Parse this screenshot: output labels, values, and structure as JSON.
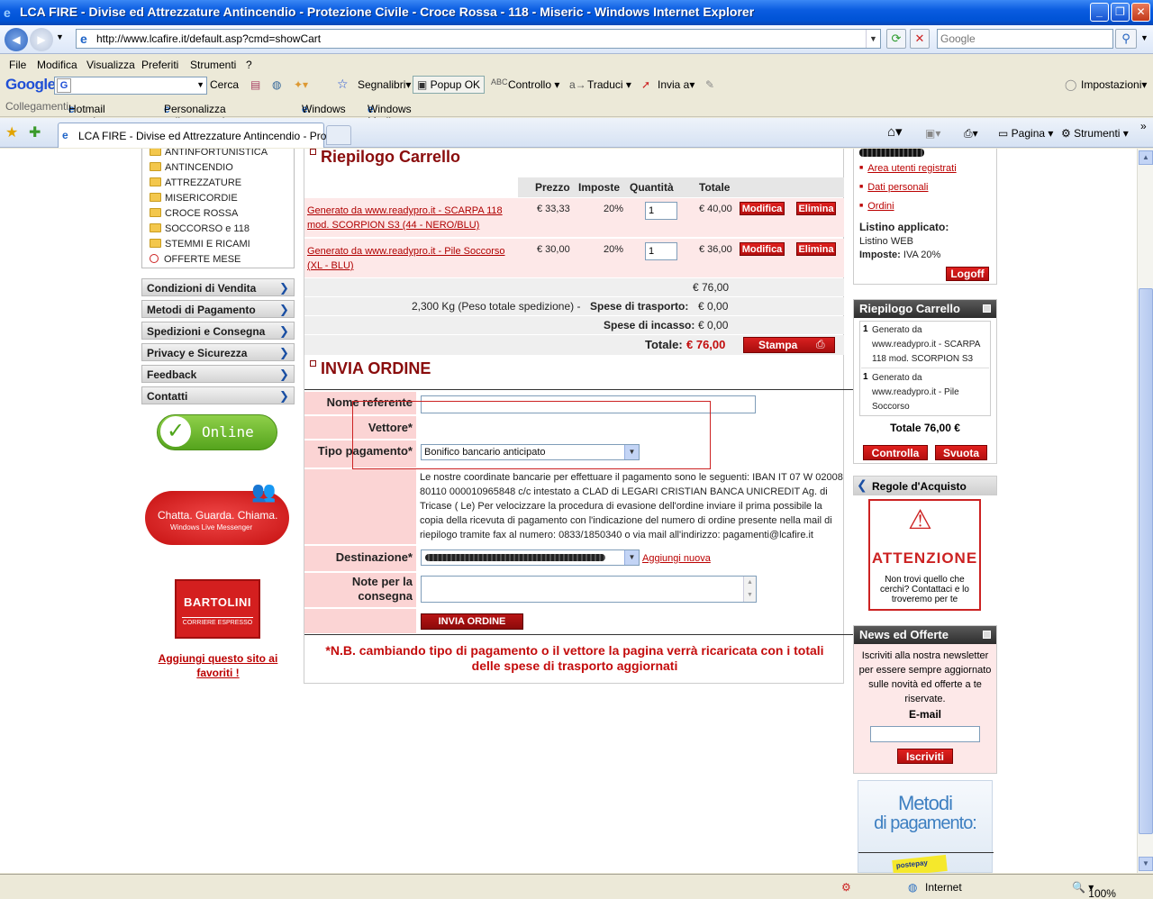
{
  "window": {
    "title": "LCA FIRE - Divise ed Attrezzature Antincendio - Protezione Civile - Croce Rossa - 118 - Miseric - Windows Internet Explorer",
    "url": "http://www.lcafire.it/default.asp?cmd=showCart",
    "search_placeholder": "Google"
  },
  "menu": [
    "File",
    "Modifica",
    "Visualizza",
    "Preferiti",
    "Strumenti",
    "?"
  ],
  "googlebar": {
    "logo": "Google",
    "cerca": "Cerca",
    "segnalibri": "Segnalibri",
    "popup": "Popup OK",
    "controllo": "Controllo",
    "traduci": "Traduci",
    "invia": "Invia a",
    "impostazioni": "Impostazioni"
  },
  "links": {
    "label": "Collegamenti",
    "items": [
      "Hotmail gratuita",
      "Personalizza collegamenti",
      "Windows",
      "Windows Media"
    ]
  },
  "tab": {
    "title": "LCA FIRE - Divise ed Attrezzature Antincendio - Prote...",
    "pagina": "Pagina",
    "strumenti": "Strumenti"
  },
  "categories": [
    "ANTINFORTUNISTICA",
    "ANTINCENDIO",
    "ATTREZZATURE",
    "MISERICORDIE",
    "CROCE ROSSA",
    "SOCCORSO e 118",
    "STEMMI E RICAMI",
    "OFFERTE MESE"
  ],
  "nav": [
    "Condizioni di Vendita",
    "Metodi di Pagamento",
    "Spedizioni e Consegna",
    "Privacy e Sicurezza",
    "Feedback",
    "Contatti"
  ],
  "left": {
    "online": "Online",
    "messenger": "Chatta. Guarda. Chiama.",
    "messenger_sub": "Windows Live Messenger",
    "bartolini": "BARTOLINI",
    "bartolini_sub": "CORRIERE ESPRESSO",
    "fav": "Aggiungi questo sito ai favoriti !"
  },
  "cart": {
    "title": "Riepilogo Carrello",
    "headers": {
      "price": "Prezzo",
      "tax": "Imposte",
      "qty": "Quantità",
      "total": "Totale"
    },
    "rows": [
      {
        "product": "Generato da www.readypro.it - SCARPA 118 mod. SCORPION S3 (44 - NERO/BLU)",
        "price": "€ 33,33",
        "tax": "20%",
        "qty": "1",
        "total": "€ 40,00"
      },
      {
        "product": "Generato da www.readypro.it - Pile Soccorso (XL - BLU)",
        "price": "€ 30,00",
        "tax": "20%",
        "qty": "1",
        "total": "€ 36,00"
      }
    ],
    "modifica": "Modifica",
    "elimina": "Elimina",
    "subtotal": "€ 76,00",
    "weight": "2,300 Kg (Peso totale spedizione) -",
    "shipping_label": "Spese di trasporto:",
    "shipping_value": "€ 0,00",
    "cod_label": "Spese di incasso:",
    "cod_value": "€ 0,00",
    "total_label": "Totale:",
    "total_value": "€ 76,00",
    "stampa": "Stampa"
  },
  "order": {
    "title": "INVIA ORDINE",
    "nome_label": "Nome referente",
    "vettore_label": "Vettore*",
    "pagamento_label": "Tipo pagamento*",
    "pagamento_value": "Bonifico bancario anticipato",
    "bank_note": "Le nostre coordinate bancarie per effettuare il pagamento sono le seguenti: IBAN IT 07 W 02008 80110 000010965848 c/c intestato a CLAD di LEGARI CRISTIAN BANCA UNICREDIT Ag. di Tricase ( Le) Per velocizzare la procedura di evasione dell'ordine inviare il prima possibile la copia della ricevuta di pagamento con l'indicazione del numero di ordine presente nella mail di riepilogo tramite fax al numero: 0833/1850340 o via mail all'indirizzo: pagamenti@lcafire.it",
    "destinazione_label": "Destinazione*",
    "aggiungi": "Aggiungi nuova",
    "note_label": "Note per la consegna",
    "submit": "INVIA ORDINE",
    "nb": "*N.B. cambiando tipo di pagamento o il vettore la pagina verrà ricaricata con i totali delle spese di trasporto aggiornati"
  },
  "user": {
    "links": [
      "Area utenti registrati",
      "Dati personali",
      "Ordini"
    ],
    "listino_label": "Listino applicato:",
    "listino_value": "Listino WEB",
    "imposte_label": "Imposte:",
    "imposte_value": "IVA 20%",
    "logoff": "Logoff"
  },
  "minicart": {
    "title": "Riepilogo Carrello",
    "items": [
      {
        "qty": "1",
        "name": "Generato da www.readypro.it - SCARPA 118 mod. SCORPION S3"
      },
      {
        "qty": "1",
        "name": "Generato da www.readypro.it - Pile Soccorso"
      }
    ],
    "total": "Totale 76,00 €",
    "controlla": "Controlla",
    "svuota": "Svuota"
  },
  "regole": {
    "title": "Regole d'Acquisto",
    "attenzione": "ATTENZIONE",
    "text": "Non trovi quello che cerchi? Contattaci e lo troveremo per te"
  },
  "news": {
    "title": "News ed Offerte",
    "text": "Iscriviti alla nostra newsletter per essere sempre aggiornato sulle novità ed offerte a te riservate.",
    "email_label": "E-mail",
    "button": "Iscriviti"
  },
  "metodi": {
    "line1": "Metodi",
    "line2": "di pagamento:",
    "badge": "postepay"
  },
  "status": {
    "zone": "Internet",
    "zoom": "100%"
  }
}
